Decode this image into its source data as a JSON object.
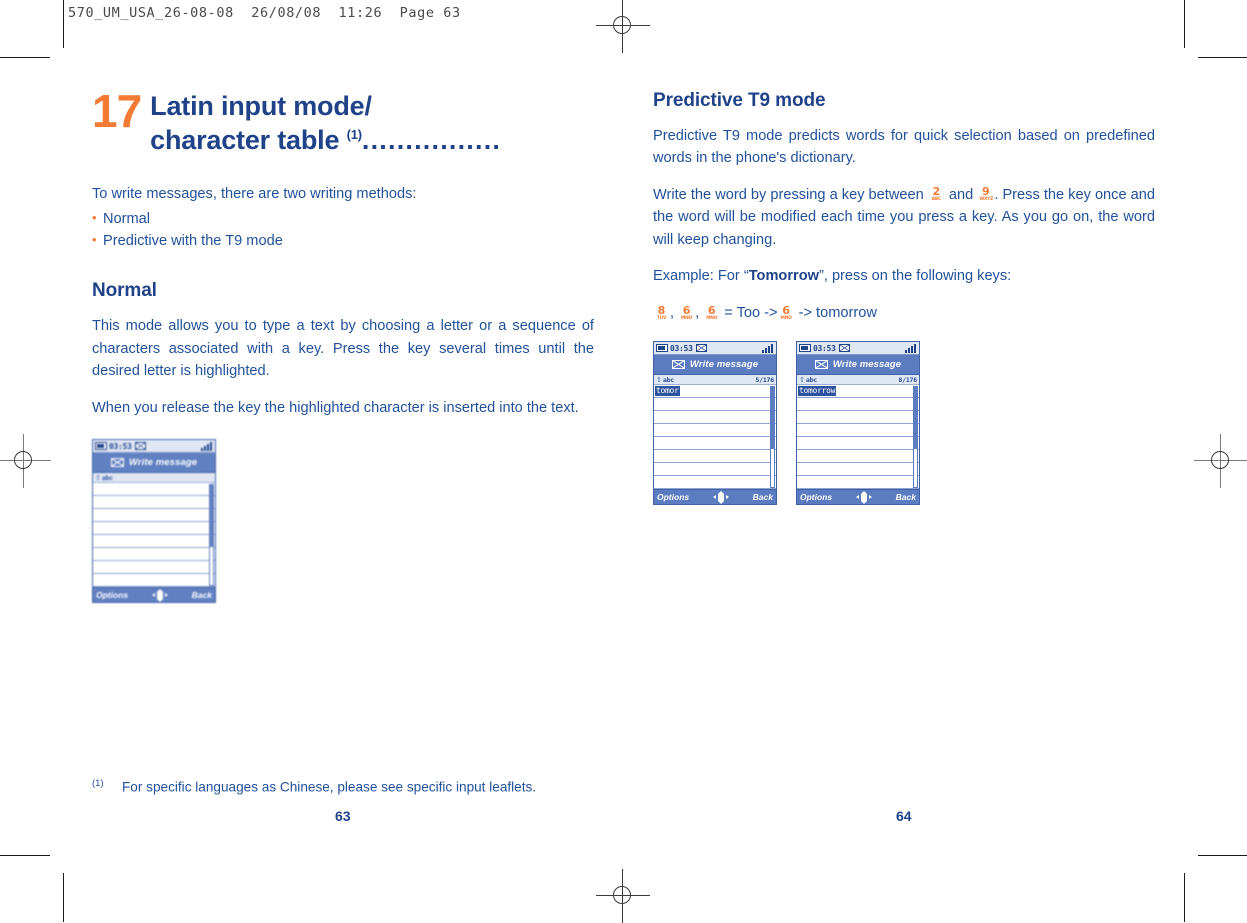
{
  "slug": "570_UM_USA_26-08-08  26/08/08  11:26  Page 63",
  "colors": {
    "brand_blue": "#22519b",
    "heading_blue": "#1f4289",
    "accent_orange": "#f47b34",
    "phone_chrome": "#5b7cc0"
  },
  "left_page": {
    "chapter_number": "17",
    "chapter_title_line1": "Latin input mode/",
    "chapter_title_line2": "character table",
    "chapter_footnote_ref": "(1)",
    "chapter_dots": "................",
    "intro": "To write messages, there are two writing methods:",
    "bullets": [
      "Normal",
      "Predictive with the T9 mode"
    ],
    "section_title": "Normal",
    "paragraphs": [
      "This mode allows you to type a text by choosing a letter or a sequence of characters associated with a key. Press the key several times until the desired letter is highlighted.",
      "When you release the key the highlighted character is inserted into the text."
    ],
    "screenshot": {
      "clock": "03:53",
      "title": "Write message",
      "mode": "abc",
      "counter": "",
      "word": "",
      "softkey_left": "Options",
      "softkey_right": "Back"
    },
    "footnote_mark": "(1)",
    "footnote_text": "For specific languages as Chinese, please see specific input leaflets.",
    "page_number": "63"
  },
  "right_page": {
    "section_title": "Predictive T9 mode",
    "paragraph_intro": "Predictive T9 mode predicts words for quick selection based on predefined words in the phone's dictionary.",
    "paragraph_write_part1": "Write the word by pressing a key between",
    "paragraph_write_and": "and",
    "paragraph_write_part2": ". Press the key once and the word will be modified each time you press a key. As you go on, the word will keep changing.",
    "key_range_from": {
      "digit": "2",
      "letters": "ABC"
    },
    "key_range_to": {
      "digit": "9",
      "letters": "WXYZ"
    },
    "example_prefix": "Example: For “",
    "example_word": "Tomorrow",
    "example_suffix": "”, press on the following keys:",
    "key_sequence": [
      {
        "digit": "8",
        "letters": "TUV"
      },
      {
        "digit": "6",
        "letters": "MNO"
      },
      {
        "digit": "6",
        "letters": "MNO"
      }
    ],
    "sequence_result": "= Too ->",
    "sequence_key_final": {
      "digit": "6",
      "letters": "MNO"
    },
    "sequence_final_result": "-> tomorrow",
    "screenshots": [
      {
        "clock": "03:53",
        "title": "Write message",
        "mode": "abc",
        "counter": "5/176",
        "word": "tomor",
        "softkey_left": "Options",
        "softkey_right": "Back"
      },
      {
        "clock": "03:53",
        "title": "Write message",
        "mode": "abc",
        "counter": "8/176",
        "word": "tomorrow",
        "softkey_left": "Options",
        "softkey_right": "Back"
      }
    ],
    "page_number": "64"
  }
}
